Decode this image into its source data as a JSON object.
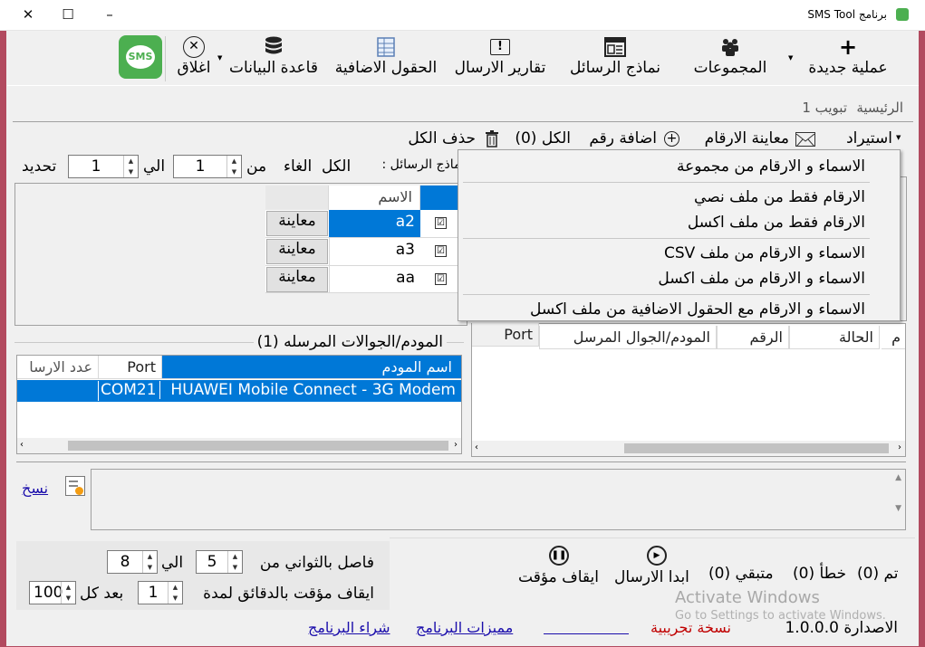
{
  "window": {
    "title": "برنامج SMS Tool",
    "controls": {
      "minimize": "–",
      "maximize": "☐",
      "close": "✕"
    }
  },
  "toolbar": {
    "new_operation": "عملية جديدة",
    "groups": "المجموعات",
    "message_templates": "نماذج الرسائل",
    "sending_reports": "تقارير الارسال",
    "extra_fields": "الحقول الاضافية",
    "database": "قاعدة البيانات",
    "close": "اغلاق",
    "sms_logo": "SMS",
    "icon_plus": "+",
    "icon_alert": "!"
  },
  "tabs": {
    "home": "الرئيسية",
    "tab1": "تبويب 1"
  },
  "actions": {
    "import": "استيراد",
    "view_numbers": "معاينة الارقام",
    "add_number": "اضافة رقم",
    "all_count": "(0) الكل",
    "delete_all": "حذف الكل"
  },
  "filter": {
    "templates_label": "نماذج الرسائل :",
    "all": "الكل",
    "cancel": "الغاء",
    "from": "من",
    "to": "الي",
    "refresh": "تحديد",
    "from_value": "1",
    "to_value": "1"
  },
  "contacts_table": {
    "header_name": "الاسم",
    "rows": [
      {
        "name": "a2",
        "checked": "☑",
        "action": "معاينة"
      },
      {
        "name": "a3",
        "checked": "☑",
        "action": "معاينة"
      },
      {
        "name": "aa",
        "checked": "☑",
        "action": "معاينة"
      }
    ]
  },
  "import_menu": {
    "items": [
      "الاسماء و الارقام من مجموعة",
      "الارقام فقط من ملف نصي",
      "الارقام فقط من ملف اكسل",
      "الاسماء و الارقام من ملف CSV",
      "الاسماء و الارقام من ملف اكسل",
      "الاسماء و الارقام مع الحقول الاضافية من ملف اكسل"
    ]
  },
  "modems": {
    "title": "المودم/الجوالات المرسله (1)",
    "headers": {
      "name": "اسم المودم",
      "port": "Port",
      "count": "عدد الارسا"
    },
    "rows": [
      {
        "name": "HUAWEI Mobile Connect - 3G Modem",
        "port": "COM21",
        "count": ""
      }
    ]
  },
  "log_table": {
    "headers": {
      "index": "م",
      "status": "الحالة",
      "number": "الرقم",
      "modem": "المودم/الجوال المرسل",
      "port": "Port"
    }
  },
  "copy": {
    "label": "نسخ"
  },
  "settings": {
    "interval_label": "فاصل بالثواني من",
    "interval_from": "5",
    "interval_to_label": "الي",
    "interval_to": "8",
    "pause_label": "ايقاف مؤقت بالدقائق لمدة",
    "pause_minutes": "1",
    "after_label": "بعد كل",
    "after_count": "100"
  },
  "sending": {
    "start": "ابدا الارسال",
    "pause": "ايقاف مؤقت",
    "status_done": "(0) تم",
    "status_error": "(0) خطأ",
    "status_remaining": "(0) متبقي"
  },
  "watermark": {
    "line1": "Activate Windows",
    "line2": "Go to Settings to activate Windows."
  },
  "footer": {
    "version": "الاصدارة 1.0.0.0",
    "trial": "نسخة تجريبية",
    "features": "مميزات البرنامج",
    "buy": "شراء البرنامج"
  },
  "colors": {
    "selection": "#0078d7",
    "window_border": "#b24a5f",
    "sms_green": "#4caf50",
    "link": "#1a0dab",
    "trial_red": "#c00000"
  }
}
